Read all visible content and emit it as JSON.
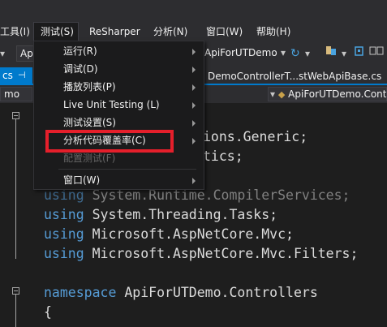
{
  "menubar": {
    "items": [
      {
        "label": "工具(I)",
        "id": "tools"
      },
      {
        "label": "测试(S)",
        "id": "test"
      },
      {
        "label": "ReSharper",
        "id": "resharper"
      },
      {
        "label": "分析(N)",
        "id": "analyze"
      },
      {
        "label": "窗口(W)",
        "id": "window"
      },
      {
        "label": "帮助(H)",
        "id": "help"
      }
    ]
  },
  "toolbar": {
    "config_value": "Ap",
    "project_value": "ApiForUTDemo",
    "refresh_icon": "refresh-icon"
  },
  "tabs": {
    "left_tab": "cs",
    "active_tab": "DemoControllerT...stWebApiBase.cs"
  },
  "navbar": {
    "left_value": "mo",
    "right_value": "ApiForUTDemo.Contro"
  },
  "test_menu": {
    "items": [
      {
        "label": "运行(R)",
        "submenu": true,
        "disabled": false
      },
      {
        "label": "调试(D)",
        "submenu": true,
        "disabled": false
      },
      {
        "label": "播放列表(P)",
        "submenu": true,
        "disabled": false
      },
      {
        "label": "Live Unit Testing (L)",
        "submenu": true,
        "disabled": false
      },
      {
        "label": "测试设置(S)",
        "submenu": true,
        "disabled": false
      },
      {
        "label": "分析代码覆盖率(C)",
        "submenu": true,
        "disabled": false
      },
      {
        "label": "配置测试(F)",
        "submenu": false,
        "disabled": true
      },
      {
        "label": "窗口(W)",
        "submenu": true,
        "disabled": false
      }
    ]
  },
  "code": {
    "line1_rest": "ions.Generic;",
    "line2_rest": "tics;",
    "line3_kw": "using",
    "line3_rest": " System.Runtime.CompilerServices;",
    "line4_kw": "using",
    "line4_rest": " System.Threading.Tasks;",
    "line5_kw": "using",
    "line5_rest": " Microsoft.AspNetCore.Mvc;",
    "line6_kw": "using",
    "line6_rest": " Microsoft.AspNetCore.Mvc.Filters;",
    "line7_kw": "namespace",
    "line7_rest": " ApiForUTDemo.Controllers",
    "line8": "{"
  },
  "colors": {
    "highlight_box": "#e51f2b",
    "keyword": "#569cd6",
    "accent": "#007acc"
  }
}
